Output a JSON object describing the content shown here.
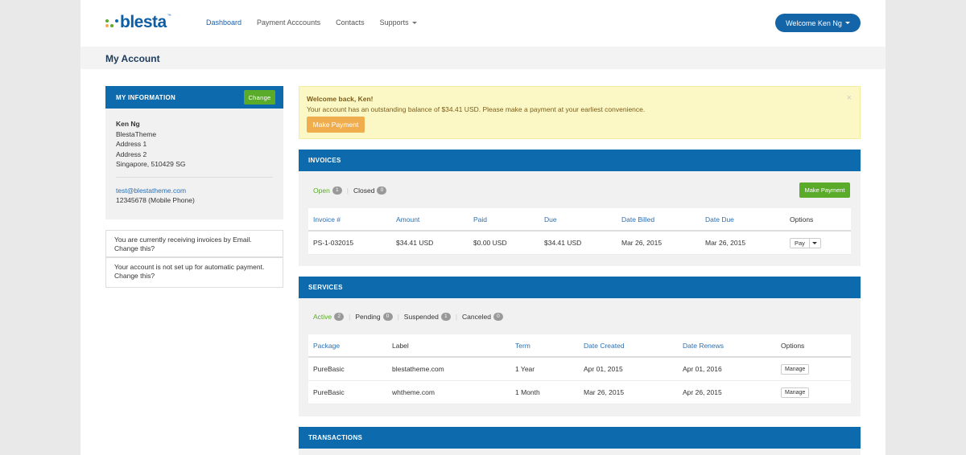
{
  "brand": {
    "name": "blesta",
    "tm": "™",
    "dot_colors": [
      "#5aab2a",
      "#0c6aad",
      "#f0ad4e"
    ]
  },
  "nav": {
    "items": [
      "Dashboard",
      "Payment Acccounts",
      "Contacts",
      "Supports"
    ],
    "welcome": "Welcome Ken Ng"
  },
  "page_title": "My Account",
  "my_info": {
    "heading": "MY INFORMATION",
    "change_label": "Change",
    "name": "Ken Ng",
    "company": "BlestaTheme",
    "address1": "Address 1",
    "address2": "Address 2",
    "city_line": "Singapore, 510429 SG",
    "email": "test@blestatheme.com",
    "phone": "12345678 (Mobile Phone)"
  },
  "notices": {
    "invoice_method_text": "You are currently receiving invoices by Email.",
    "invoice_method_link": "Change this?",
    "autopay_text": "Your account is not set up for automatic payment.",
    "autopay_link": "Change this?"
  },
  "alert": {
    "title": "Welcome back, Ken!",
    "message": "Your account has an outstanding balance of $34.41 USD. Please make a payment at your earliest convenience.",
    "button": "Make Payment",
    "close": "×"
  },
  "invoices": {
    "heading": "INVOICES",
    "filters": [
      {
        "label": "Open",
        "count": "1"
      },
      {
        "label": "Closed",
        "count": "0"
      }
    ],
    "make_payment": "Make Payment",
    "columns": [
      "Invoice #",
      "Amount",
      "Paid",
      "Due",
      "Date Billed",
      "Date Due",
      "Options"
    ],
    "rows": [
      {
        "invoice": "PS-1-032015",
        "amount": "$34.41 USD",
        "paid": "$0.00 USD",
        "due": "$34.41 USD",
        "billed": "Mar 26, 2015",
        "date_due": "Mar 26, 2015",
        "option": "Pay"
      }
    ]
  },
  "services": {
    "heading": "SERVICES",
    "filters": [
      {
        "label": "Active",
        "count": "2"
      },
      {
        "label": "Pending",
        "count": "0"
      },
      {
        "label": "Suspended",
        "count": "1"
      },
      {
        "label": "Canceled",
        "count": "0"
      }
    ],
    "columns": [
      "Package",
      "Label",
      "Term",
      "Date Created",
      "Date Renews",
      "Options"
    ],
    "rows": [
      {
        "package": "PureBasic",
        "label": "blestatheme.com",
        "term": "1 Year",
        "created": "Apr 01, 2015",
        "renews": "Apr 01, 2016",
        "option": "Manage"
      },
      {
        "package": "PureBasic",
        "label": "whtheme.com",
        "term": "1 Month",
        "created": "Mar 26, 2015",
        "renews": "Apr 26, 2015",
        "option": "Manage"
      }
    ]
  },
  "transactions": {
    "heading": "TRANSACTIONS"
  }
}
